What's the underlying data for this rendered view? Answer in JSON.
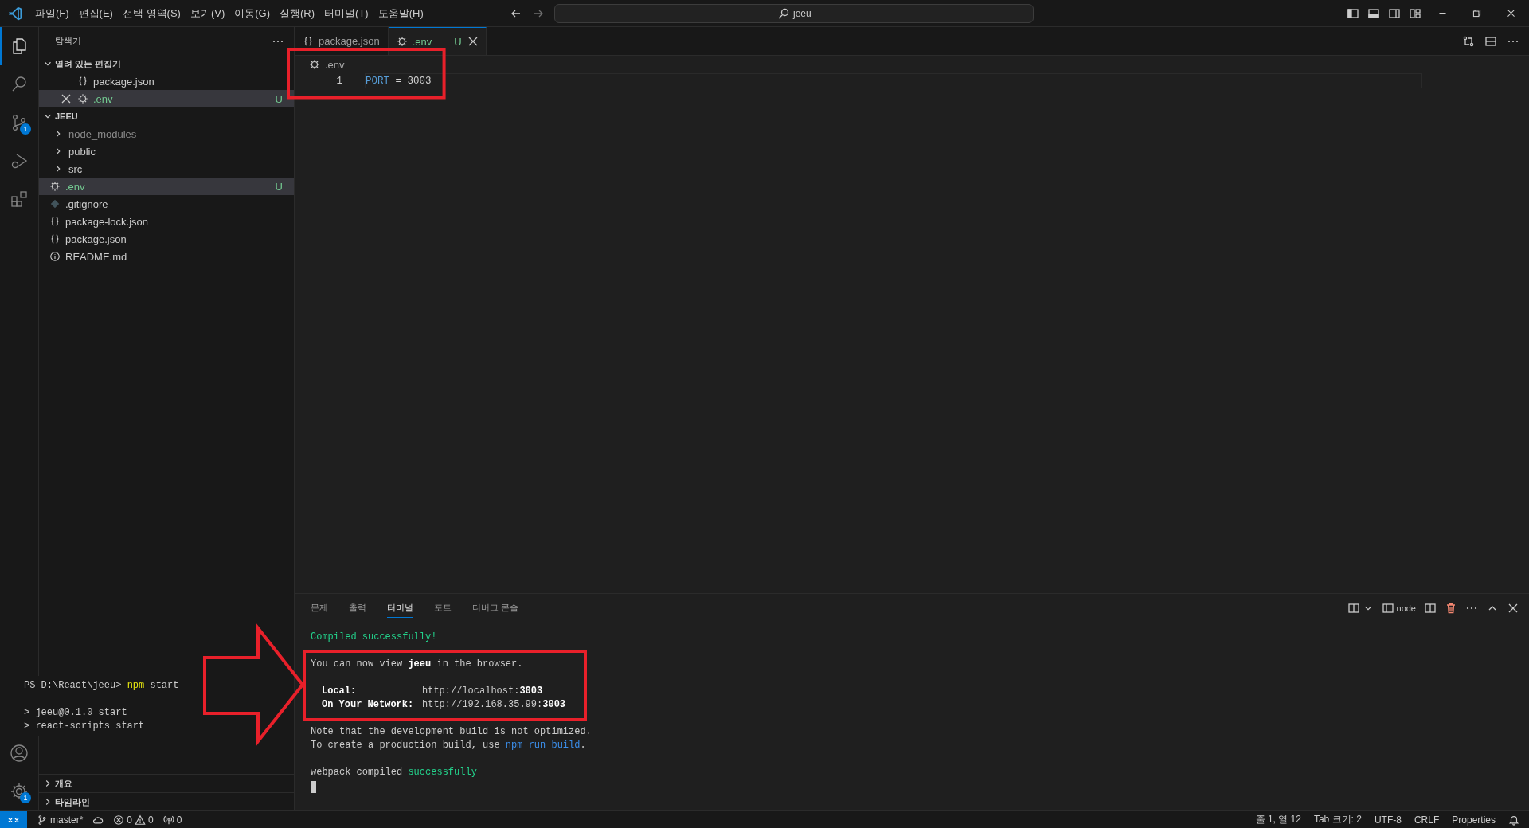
{
  "title_bar": {
    "menu": [
      "파일(F)",
      "편집(E)",
      "선택 영역(S)",
      "보기(V)",
      "이동(G)",
      "실행(R)",
      "터미널(T)",
      "도움말(H)"
    ],
    "search": {
      "value": "jeeu"
    }
  },
  "activity_bar": {
    "top": [
      {
        "kind": "explorer",
        "selected": true
      },
      {
        "kind": "search",
        "selected": false
      },
      {
        "kind": "source-control",
        "selected": false,
        "badge": "1"
      },
      {
        "kind": "run-debug",
        "selected": false
      },
      {
        "kind": "extensions",
        "selected": false
      }
    ],
    "bottom": [
      {
        "kind": "account"
      },
      {
        "kind": "settings",
        "badge": "1"
      }
    ]
  },
  "sidebar": {
    "title": "탐색기",
    "sections": [
      {
        "title": "열려 있는 편집기",
        "expanded": true,
        "items": [
          {
            "name": "package.json",
            "kind": "json",
            "selected": false
          },
          {
            "name": ".env",
            "kind": "env",
            "selected": true,
            "status": "U"
          }
        ]
      },
      {
        "title": "JEEU",
        "expanded": true,
        "items": [
          {
            "name": "node_modules",
            "kind": "folder",
            "expanded": false,
            "ignored": true,
            "selected": false
          },
          {
            "name": "public",
            "kind": "folder",
            "expanded": false,
            "ignored": false,
            "selected": false
          },
          {
            "name": "src",
            "kind": "folder",
            "expanded": false,
            "ignored": false,
            "selected": false
          },
          {
            "name": ".env",
            "kind": "env",
            "selected": true,
            "status": "U"
          },
          {
            "name": ".gitignore",
            "kind": "gitignore",
            "selected": false
          },
          {
            "name": "package-lock.json",
            "kind": "json",
            "selected": false
          },
          {
            "name": "package.json",
            "kind": "json",
            "selected": false
          },
          {
            "name": "README.md",
            "kind": "readme",
            "selected": false
          }
        ]
      }
    ],
    "collapsed_sections": [
      {
        "title": "개요",
        "expanded": false
      },
      {
        "title": "타임라인",
        "expanded": false
      }
    ]
  },
  "tabs": [
    {
      "label": "package.json",
      "kind": "json",
      "selected": false
    },
    {
      "label": ".env",
      "kind": "env",
      "selected": true,
      "status": "U"
    }
  ],
  "breadcrumb": {
    "kind": "env",
    "label": ".env"
  },
  "editor": {
    "lines": [
      {
        "number": "1",
        "key": "PORT",
        "operator": "=",
        "value": "3003"
      }
    ]
  },
  "panel": {
    "tabs": [
      {
        "label": "문제",
        "selected": false
      },
      {
        "label": "출력",
        "selected": false
      },
      {
        "label": "터미널",
        "selected": true
      },
      {
        "label": "포트",
        "selected": false
      },
      {
        "label": "디버그 콘솔",
        "selected": false
      }
    ],
    "terminal_name": "node",
    "terminal_blocks": [
      [
        {
          "kind": "text",
          "segments": [
            {
              "text": "Compiled successfully!",
              "kind": "success"
            }
          ]
        }
      ],
      [
        {
          "kind": "text",
          "segments": [
            {
              "text": "You can now view ",
              "kind": "plain"
            },
            {
              "text": "jeeu",
              "kind": "bold"
            },
            {
              "text": " in the browser.",
              "kind": "plain"
            }
          ]
        }
      ],
      [
        {
          "kind": "address",
          "label": "Local:",
          "url": "http://localhost:",
          "port": "3003"
        },
        {
          "kind": "address",
          "label": "On Your Network:",
          "url": "http://192.168.35.99:",
          "port": "3003"
        }
      ],
      [
        {
          "kind": "text",
          "segments": [
            {
              "text": "Note that the development build is not optimized.",
              "kind": "plain"
            }
          ]
        },
        {
          "kind": "text",
          "segments": [
            {
              "text": "To create a production build, use ",
              "kind": "plain"
            },
            {
              "text": "npm run build",
              "kind": "link"
            },
            {
              "text": ".",
              "kind": "plain"
            }
          ]
        }
      ],
      [
        {
          "kind": "text",
          "segments": [
            {
              "text": "webpack compiled ",
              "kind": "plain"
            },
            {
              "text": "successfully",
              "kind": "success"
            }
          ]
        }
      ]
    ]
  },
  "pasted_terminal": {
    "blocks": [
      [
        {
          "kind": "text",
          "segments": [
            {
              "text": "PS D:\\React\\jeeu> ",
              "kind": "plain"
            },
            {
              "text": "npm",
              "kind": "command"
            },
            {
              "text": " start",
              "kind": "plain"
            }
          ]
        }
      ],
      [
        {
          "kind": "text",
          "segments": [
            {
              "text": "> jeeu@0.1.0 start",
              "kind": "plain"
            }
          ]
        },
        {
          "kind": "text",
          "segments": [
            {
              "text": "> react-scripts start",
              "kind": "plain"
            }
          ]
        }
      ]
    ]
  },
  "status_bar": {
    "left": [
      {
        "kind": "remote"
      },
      {
        "kind": "branch",
        "text": "master*"
      },
      {
        "kind": "sync"
      },
      {
        "kind": "problems",
        "errors": "0",
        "warnings": "0"
      },
      {
        "kind": "ports",
        "text": "0"
      }
    ],
    "right": [
      {
        "kind": "text",
        "text": "줄 1, 열 12"
      },
      {
        "kind": "text",
        "text": "Tab 크기: 2"
      },
      {
        "kind": "text",
        "text": "UTF-8"
      },
      {
        "kind": "text",
        "text": "CRLF"
      },
      {
        "kind": "text",
        "text": "Properties"
      },
      {
        "kind": "bell"
      }
    ]
  }
}
